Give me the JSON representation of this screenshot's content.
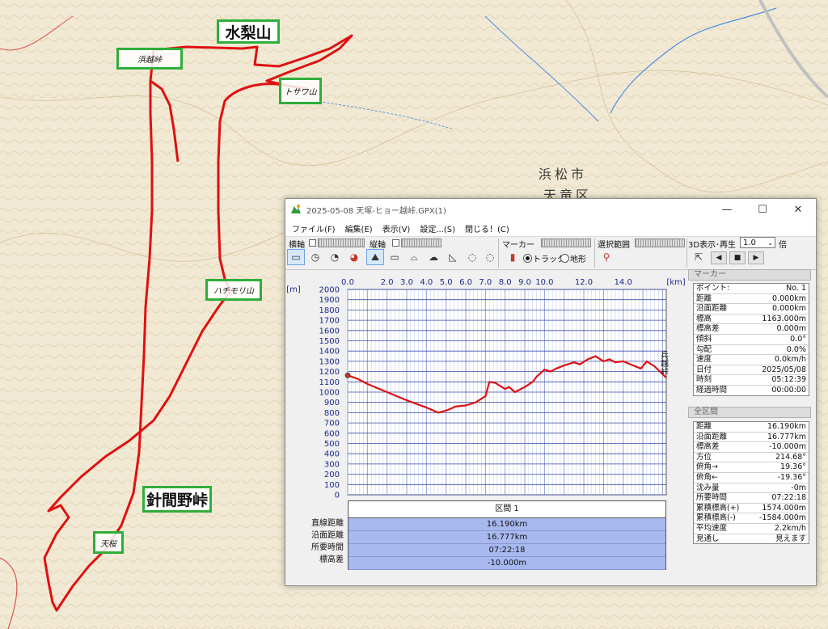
{
  "map": {
    "labels": {
      "mizunashi": "水梨山",
      "hamakoshi": "浜越峠",
      "tosawa": "トサワ山",
      "hachimori": "ハチモリ山",
      "harimano": "針間野峠",
      "tenkan": "天桜"
    },
    "city": {
      "line1": "浜松市",
      "line2": "天竜区"
    },
    "track_color": "#e01010",
    "highlight_color": "#2fae3a"
  },
  "window": {
    "title": "2025-05-08 天塚-ヒョー越峠.GPX(1)",
    "controls": {
      "minimize": "—",
      "maximize": "☐",
      "close": "✕"
    },
    "menu": [
      "ファイル(F)",
      "編集(E)",
      "表示(V)",
      "設定...(S)",
      "閉じる！(C)"
    ],
    "toolbar": {
      "horizontal_axis": "横軸",
      "vertical_axis": "縦軸",
      "marker": "マーカー",
      "selection": "選択範囲",
      "display3d": "3D表示･再生",
      "zoom_value": "1.0",
      "zoom_unit": "倍",
      "radio_track": "トラック",
      "radio_terrain": "地形",
      "selected_mode": "track",
      "icons": [
        "ruler-icon",
        "clock-icon",
        "count-icon",
        "pie-icon",
        "mountain-icon",
        "flat-ruler-icon",
        "curve-icon",
        "cloud-icon",
        "slope-icon",
        "circle-dotted-icon",
        "circle-dotted2-icon"
      ]
    }
  },
  "chart_data": {
    "type": "line",
    "xlabel": "[km]",
    "ylabel": "[m]",
    "x_ticks": [
      0.0,
      2.0,
      3.0,
      4.0,
      5.0,
      6.0,
      7.0,
      8.0,
      9.0,
      10.0,
      12.0,
      14.0
    ],
    "x_tick_labels": [
      "0.0",
      "2.0",
      "3.0",
      "4.0",
      "5.0",
      "6.0",
      "7.0",
      "8.0",
      "9.0",
      "10.0",
      "12.0",
      "14.0"
    ],
    "y_ticks": [
      0,
      100,
      200,
      300,
      400,
      500,
      600,
      700,
      800,
      900,
      1000,
      1100,
      1200,
      1300,
      1400,
      1500,
      1600,
      1700,
      1800,
      1900,
      2000
    ],
    "xlim": [
      0,
      16.19
    ],
    "ylim": [
      0,
      2000
    ],
    "end_label": "兵越峠",
    "series": [
      {
        "x": [
          0,
          0.5,
          1.0,
          2.0,
          3.0,
          4.0,
          4.6,
          5.0,
          5.5,
          6.0,
          6.5,
          7.0,
          7.2,
          7.5,
          8.0,
          8.2,
          8.5,
          9.0,
          9.4,
          9.6,
          10.0,
          10.3,
          10.6,
          11.0,
          11.5,
          11.8,
          12.2,
          12.6,
          13.0,
          13.3,
          13.6,
          14.0,
          14.5,
          14.9,
          15.2,
          15.6,
          16.19
        ],
        "y": [
          1163,
          1130,
          1080,
          1000,
          920,
          850,
          800,
          820,
          860,
          870,
          900,
          960,
          1100,
          1090,
          1030,
          1050,
          1000,
          1050,
          1100,
          1150,
          1220,
          1200,
          1230,
          1260,
          1290,
          1270,
          1320,
          1350,
          1300,
          1320,
          1290,
          1300,
          1260,
          1230,
          1300,
          1250,
          1140
        ]
      }
    ]
  },
  "marker_panel": {
    "header": "マーカー",
    "rows": [
      [
        "ポイント:",
        "No. 1"
      ],
      [
        "距離",
        "0.000km"
      ],
      [
        "沿面距離",
        "0.000km"
      ],
      [
        "標高",
        "1163.000m"
      ],
      [
        "標高差",
        "0.000m"
      ],
      [
        "傾斜",
        "0.0°"
      ],
      [
        "勾配",
        "0.0%"
      ],
      [
        "速度",
        "0.0km/h"
      ],
      [
        "日付",
        "2025/05/08"
      ],
      [
        "時刻",
        "05:12:39"
      ],
      [
        "経過時間",
        "00:00:00"
      ]
    ]
  },
  "total_panel": {
    "header": "全区間",
    "rows": [
      [
        "距離",
        "16.190km"
      ],
      [
        "沿面距離",
        "16.777km"
      ],
      [
        "標高差",
        "-10.000m"
      ],
      [
        "方位",
        "214.68°"
      ],
      [
        "俯角→",
        "19.36°"
      ],
      [
        "俯角←",
        "-19.36°"
      ],
      [
        "沈み量",
        "-0m"
      ],
      [
        "所要時間",
        "07:22:18"
      ],
      [
        "累積標高(+)",
        "1574.000m"
      ],
      [
        "累積標高(-)",
        "-1584.000m"
      ],
      [
        "平均速度",
        "2.2km/h"
      ],
      [
        "見通し",
        "見えます"
      ]
    ]
  },
  "summary": {
    "section_title": "区間 1",
    "labels": [
      "直線距離",
      "沿面距離",
      "所要時間",
      "標高差"
    ],
    "values": [
      "16.190km",
      "16.777km",
      "07:22:18",
      "-10.000m"
    ]
  }
}
